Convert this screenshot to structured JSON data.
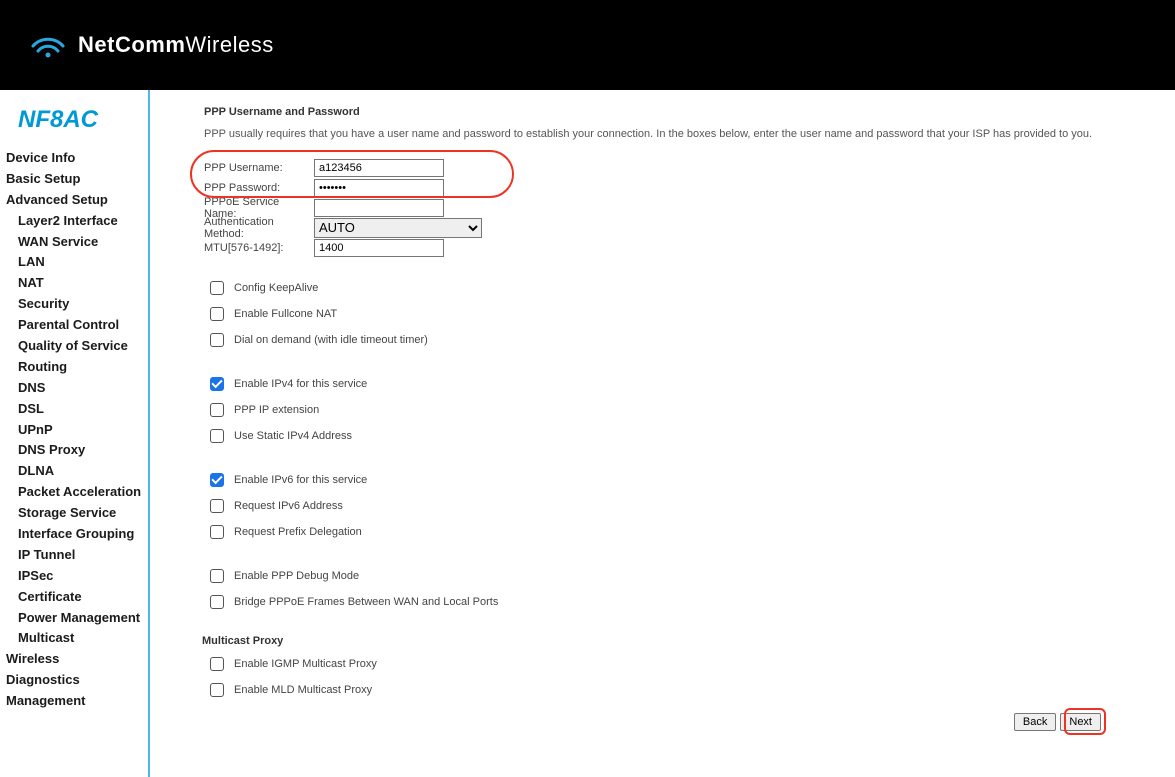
{
  "brand": {
    "bold": "NetComm",
    "light": "Wireless"
  },
  "model": "NF8AC",
  "nav": {
    "device_info": "Device Info",
    "basic_setup": "Basic Setup",
    "advanced_setup": "Advanced Setup",
    "adv_items": [
      "Layer2 Interface",
      "WAN Service",
      "LAN",
      "NAT",
      "Security",
      "Parental Control",
      "Quality of Service",
      "Routing",
      "DNS",
      "DSL",
      "UPnP",
      "DNS Proxy",
      "DLNA",
      "Packet Acceleration",
      "Storage Service",
      "Interface Grouping",
      "IP Tunnel",
      "IPSec",
      "Certificate",
      "Power Management",
      "Multicast"
    ],
    "wireless": "Wireless",
    "diagnostics": "Diagnostics",
    "management": "Management"
  },
  "page": {
    "title": "PPP Username and Password",
    "intro": "PPP usually requires that you have a user name and password to establish your connection. In the boxes below, enter the user name and password that your ISP has provided to you.",
    "labels": {
      "username": "PPP Username:",
      "password": "PPP Password:",
      "service": "PPPoE Service Name:",
      "auth": "Authentication Method:",
      "mtu": "MTU[576-1492]:"
    },
    "values": {
      "username": "a123456",
      "password": "•••••••",
      "service": "",
      "auth": "AUTO",
      "mtu": "1400"
    },
    "auth_options": [
      "AUTO"
    ],
    "checks": {
      "keepalive": "Config KeepAlive",
      "fullcone": "Enable Fullcone NAT",
      "dod": "Dial on demand (with idle timeout timer)",
      "ipv4": "Enable IPv4 for this service",
      "pppip": "PPP IP extension",
      "staticv4": "Use Static IPv4 Address",
      "ipv6": "Enable IPv6 for this service",
      "reqv6": "Request IPv6 Address",
      "reqpd": "Request Prefix Delegation",
      "debug": "Enable PPP Debug Mode",
      "bridge": "Bridge PPPoE Frames Between WAN and Local Ports"
    },
    "multicast_title": "Multicast Proxy",
    "mc_checks": {
      "igmp": "Enable IGMP Multicast Proxy",
      "mld": "Enable MLD Multicast Proxy"
    },
    "buttons": {
      "back": "Back",
      "next": "Next"
    }
  }
}
